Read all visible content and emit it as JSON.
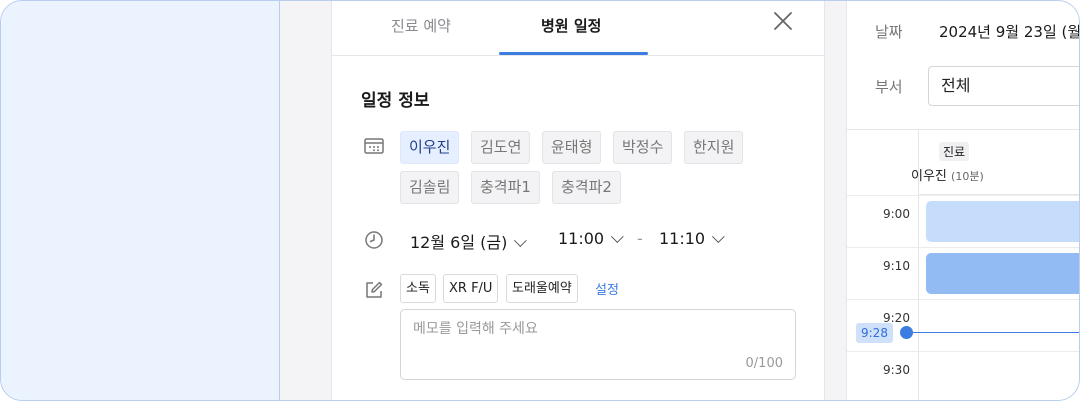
{
  "tabs": [
    {
      "label": "진료 예약",
      "active": false
    },
    {
      "label": "병원 일정",
      "active": true
    }
  ],
  "section_title": "일정 정보",
  "staff_chips": [
    {
      "label": "이우진",
      "selected": true
    },
    {
      "label": "김도연",
      "selected": false
    },
    {
      "label": "윤태형",
      "selected": false
    },
    {
      "label": "박정수",
      "selected": false
    },
    {
      "label": "한지원",
      "selected": false
    },
    {
      "label": "김솔림",
      "selected": false
    },
    {
      "label": "충격파1",
      "selected": false
    },
    {
      "label": "충격파2",
      "selected": false
    }
  ],
  "schedule": {
    "date": "12월 6일 (금)",
    "start_time": "11:00",
    "end_time": "11:10",
    "separator": "-"
  },
  "memo_tags": [
    "소독",
    "XR F/U",
    "도래울예약"
  ],
  "memo_settings_label": "설정",
  "memo": {
    "placeholder": "메모를 입력해 주세요",
    "value": "",
    "counter": "0/100"
  },
  "calendar": {
    "date_label": "날짜",
    "date_value": "2024년 9월 23일 (월",
    "dept_label": "부서",
    "dept_value": "전체",
    "column_tag": "진료",
    "column_name": "이우진",
    "column_duration": "(10분)",
    "time_slots": [
      "9:00",
      "9:10",
      "9:20",
      "9:30"
    ],
    "now_time": "9:28"
  },
  "colors": {
    "accent": "#3b7de0",
    "chip_selected_bg": "#e6efff",
    "event_light": "#c5dcfb",
    "event_dark": "#92bbf3",
    "left_pane": "#ebf3fe"
  },
  "icons": [
    "close-icon",
    "calendar-icon",
    "clock-icon",
    "memo-edit-icon",
    "chevron-down-icon"
  ]
}
